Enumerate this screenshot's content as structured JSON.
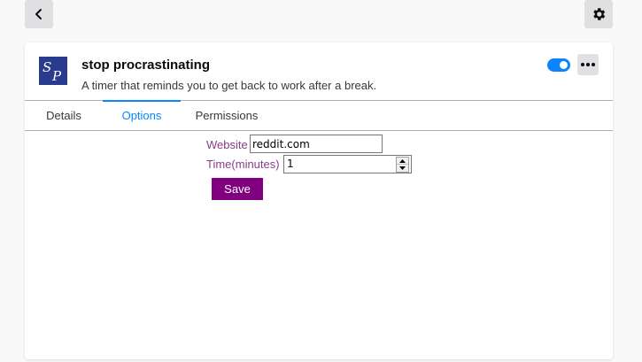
{
  "addon": {
    "logo_text": "SP",
    "name": "stop procrastinating",
    "description": "A timer that reminds you to get back to work after a break.",
    "enabled": true
  },
  "tabs": [
    {
      "label": "Details",
      "active": false
    },
    {
      "label": "Options",
      "active": true
    },
    {
      "label": "Permissions",
      "active": false
    }
  ],
  "options": {
    "website_label": "Website",
    "website_value": "reddit.com",
    "time_label": "Time(minutes)",
    "time_value": "1",
    "save_label": "Save"
  },
  "colors": {
    "accent": "#0a84ff",
    "label": "#8b3c8b",
    "save_button": "#800080",
    "logo_bg": "#2a3a8c"
  },
  "icons": {
    "back": "chevron-left-icon",
    "settings": "gear-icon",
    "more": "ellipsis-icon"
  }
}
